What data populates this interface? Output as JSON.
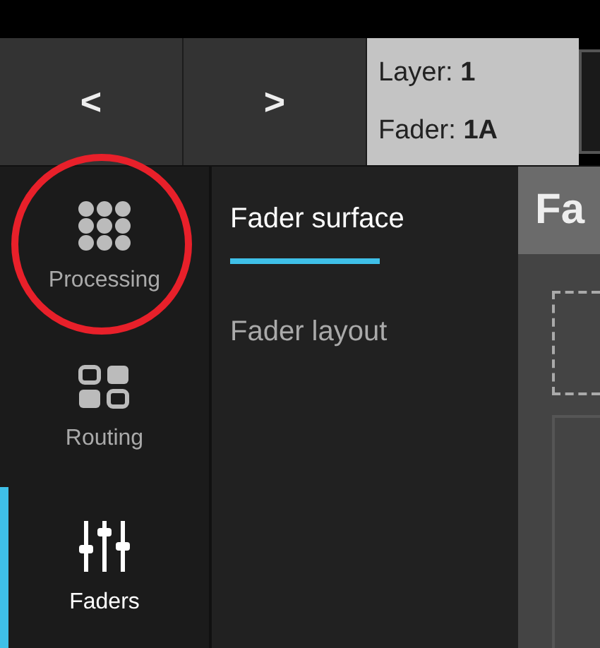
{
  "header": {
    "prev_label": "<",
    "next_label": ">",
    "info": [
      "Layer: **1**",
      "Fader: **1A**"
    ]
  },
  "sidebar": {
    "items": [
      {
        "label": "Processing",
        "kind": "grid",
        "selected": false,
        "highlighted": true
      },
      {
        "label": "Routing",
        "kind": "blocks",
        "selected": false,
        "highlighted": false
      },
      {
        "label": "Faders",
        "kind": "sliders",
        "selected": true,
        "highlighted": false
      }
    ]
  },
  "tabs": [
    {
      "label": "Fader surface",
      "selected": true
    },
    {
      "label": "Fader layout",
      "selected": false
    }
  ],
  "panel": {
    "title": "Fa"
  }
}
